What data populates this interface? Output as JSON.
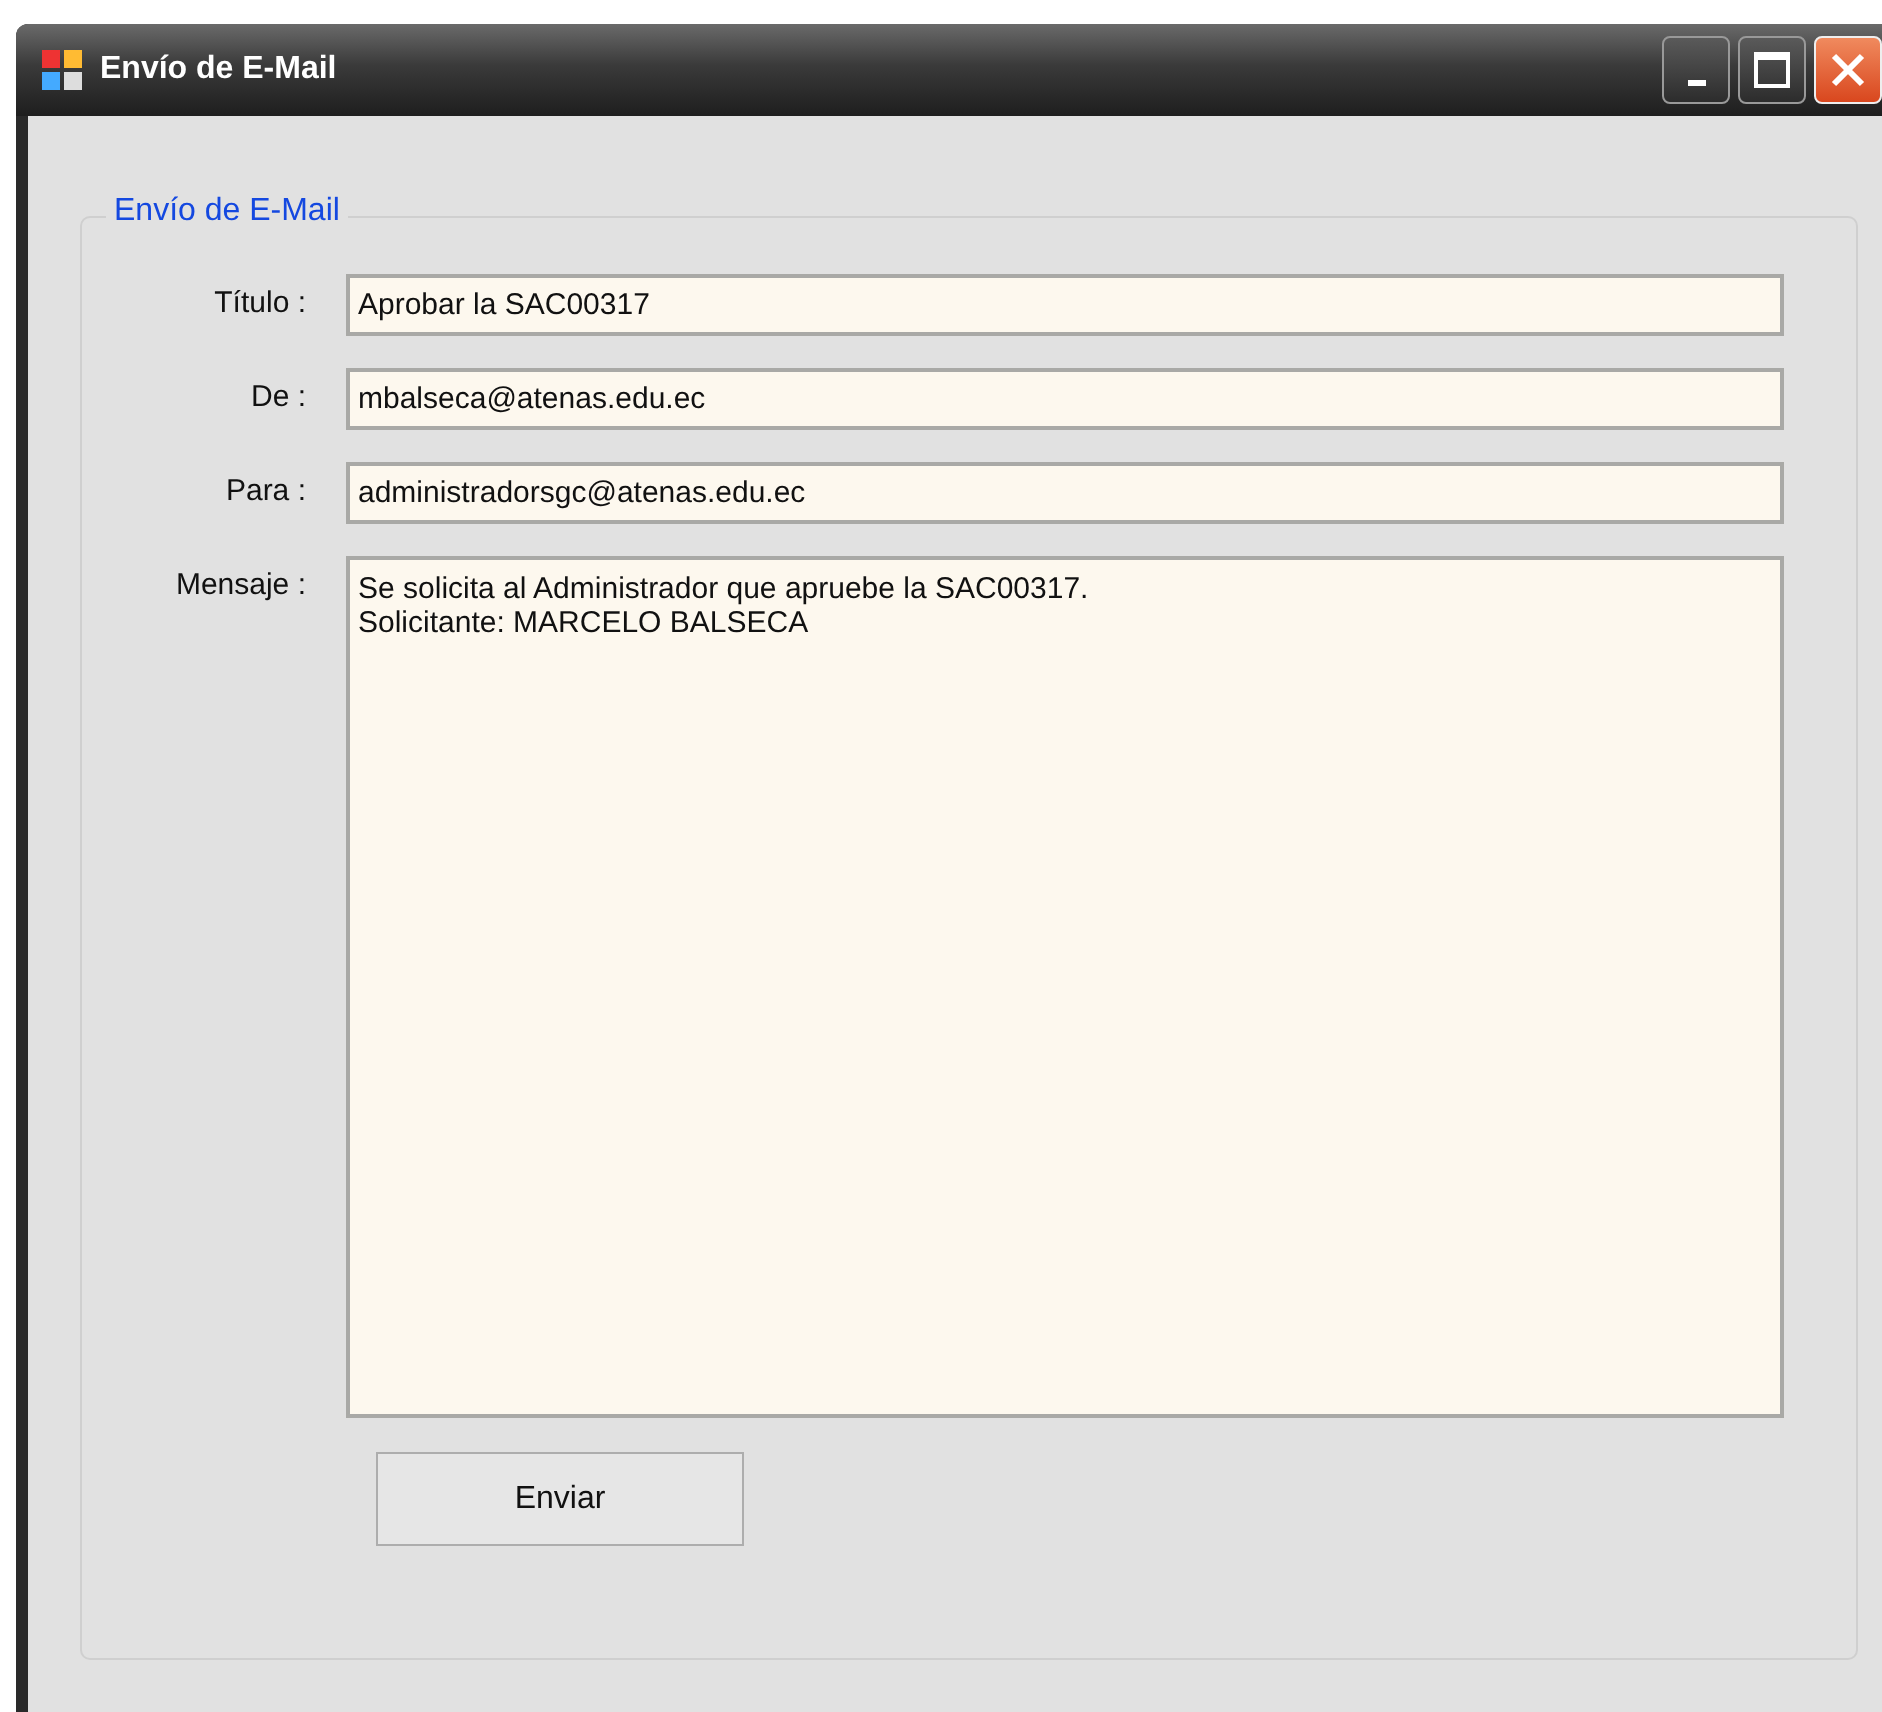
{
  "window": {
    "title": "Envío de E-Mail"
  },
  "group": {
    "title": "Envío de E-Mail"
  },
  "fields": [
    {
      "kind": "line",
      "label": "Título :",
      "value": "Aprobar la SAC00317"
    },
    {
      "kind": "line",
      "label": "De :",
      "value": "mbalseca@atenas.edu.ec"
    },
    {
      "kind": "line",
      "label": "Para :",
      "value": "administradorsgc@atenas.edu.ec"
    },
    {
      "kind": "multiline",
      "label": "Mensaje :",
      "value": "Se solicita al Administrador que apruebe la SAC00317.\nSolicitante: MARCELO BALSECA"
    }
  ],
  "buttons": [
    "Enviar"
  ]
}
